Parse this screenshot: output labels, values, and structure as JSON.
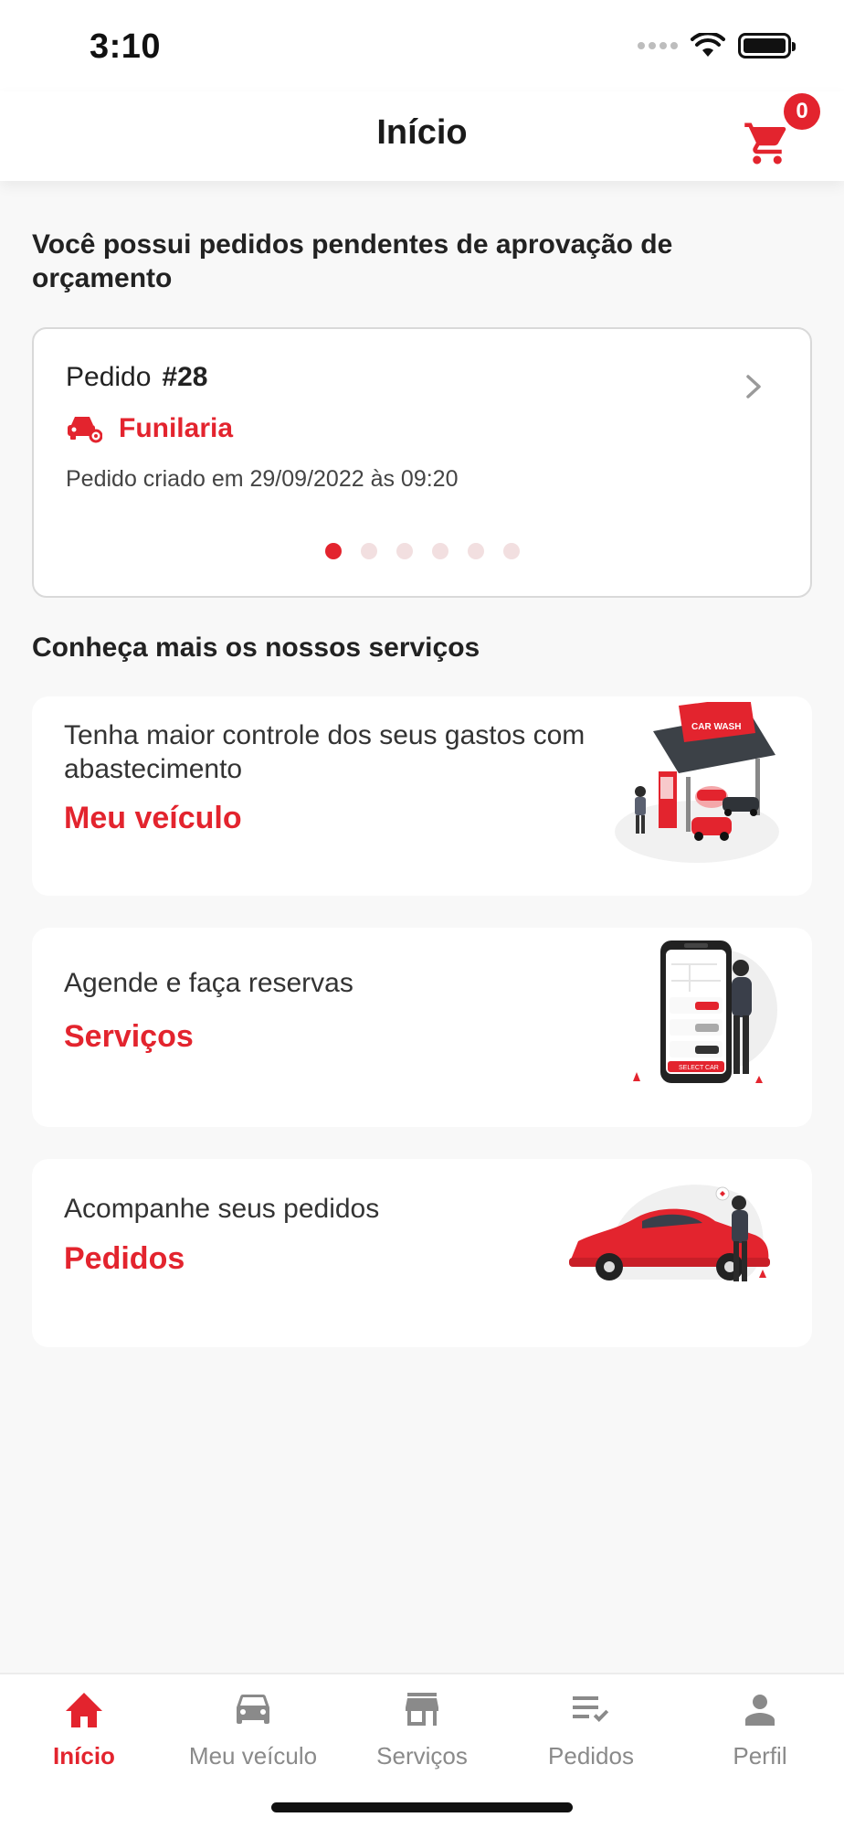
{
  "status_bar": {
    "time": "3:10"
  },
  "header": {
    "title": "Início",
    "cart_count": "0"
  },
  "pending": {
    "title": "Você possui pedidos pendentes de aprovação de orçamento",
    "order": {
      "label": "Pedido",
      "number": "#28",
      "service": "Funilaria",
      "created": "Pedido criado em 29/09/2022 às 09:20"
    },
    "pager": {
      "count": 6,
      "active": 1
    }
  },
  "services": {
    "title": "Conheça mais os nossos serviços",
    "cards": [
      {
        "description": "Tenha maior controle dos seus gastos com abastecimento",
        "link": "Meu veículo",
        "illustration": "car-wash-icon"
      },
      {
        "description": "Agende e faça reservas",
        "link": "Serviços",
        "illustration": "phone-select-car-icon"
      },
      {
        "description": "Acompanhe seus pedidos",
        "link": "Pedidos",
        "illustration": "red-car-icon"
      }
    ]
  },
  "tabbar": {
    "items": [
      {
        "label": "Início",
        "icon": "home-icon",
        "active": true
      },
      {
        "label": "Meu veículo",
        "icon": "car-icon",
        "active": false
      },
      {
        "label": "Serviços",
        "icon": "store-icon",
        "active": false
      },
      {
        "label": "Pedidos",
        "icon": "list-check-icon",
        "active": false
      },
      {
        "label": "Perfil",
        "icon": "person-icon",
        "active": false
      }
    ]
  },
  "colors": {
    "accent": "#e3242e",
    "inactive": "#8a8a8a",
    "background": "#f8f8f8"
  }
}
